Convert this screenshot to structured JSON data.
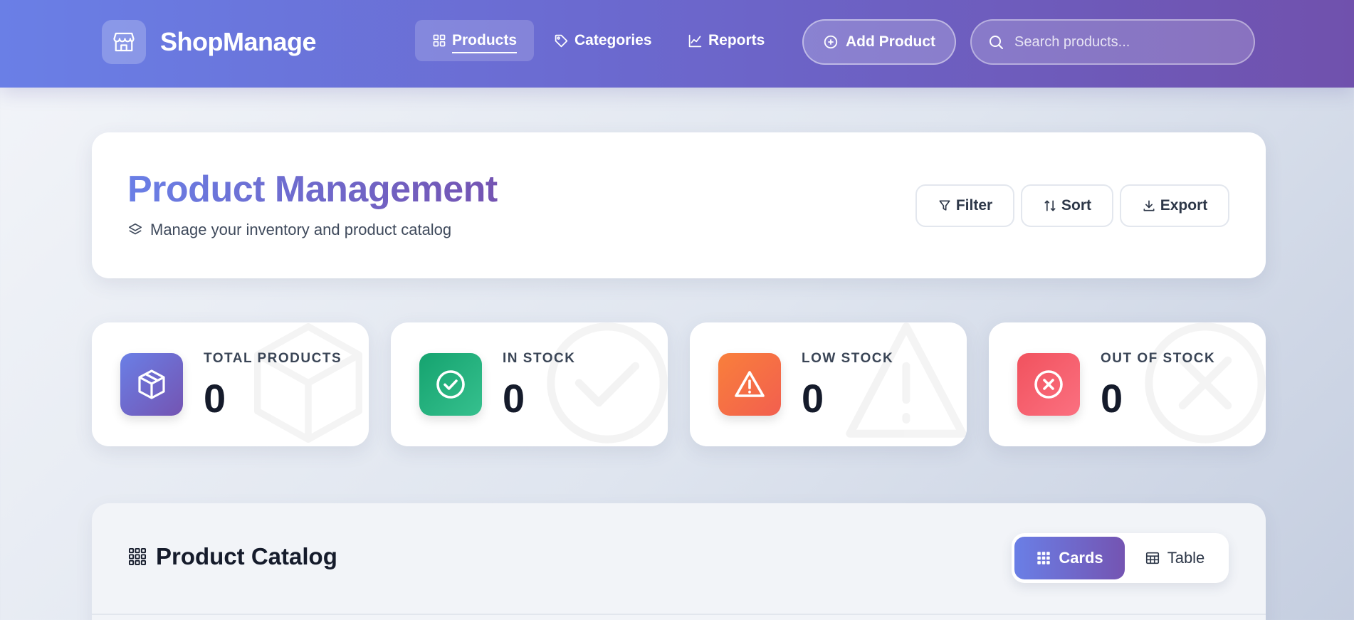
{
  "header": {
    "brand": "ShopManage",
    "logo_icon": "store-icon",
    "nav": [
      {
        "label": "Products",
        "icon": "grid-icon",
        "active": true
      },
      {
        "label": "Categories",
        "icon": "tag-icon",
        "active": false
      },
      {
        "label": "Reports",
        "icon": "chart-line-icon",
        "active": false
      }
    ],
    "add_button_label": "Add Product",
    "search_placeholder": "Search products..."
  },
  "title_card": {
    "title": "Product Management",
    "subtitle": "Manage your inventory and product catalog",
    "actions": [
      {
        "label": "Filter",
        "icon": "filter-icon"
      },
      {
        "label": "Sort",
        "icon": "sort-icon"
      },
      {
        "label": "Export",
        "icon": "download-icon"
      }
    ]
  },
  "stats": [
    {
      "label": "TOTAL PRODUCTS",
      "value": "0",
      "icon": "box-icon",
      "color_from": "#6a7fe6",
      "color_to": "#7454b2"
    },
    {
      "label": "IN STOCK",
      "value": "0",
      "icon": "check-circle-icon",
      "color_from": "#15a36f",
      "color_to": "#36c08e"
    },
    {
      "label": "LOW STOCK",
      "value": "0",
      "icon": "warning-icon",
      "color_from": "#f97f3b",
      "color_to": "#f25f4f"
    },
    {
      "label": "OUT OF STOCK",
      "value": "0",
      "icon": "x-circle-icon",
      "color_from": "#f1525e",
      "color_to": "#fb7080"
    }
  ],
  "catalog": {
    "title": "Product Catalog",
    "views": [
      {
        "label": "Cards",
        "icon": "grid-dots-icon",
        "active": true
      },
      {
        "label": "Table",
        "icon": "table-icon",
        "active": false
      }
    ]
  }
}
